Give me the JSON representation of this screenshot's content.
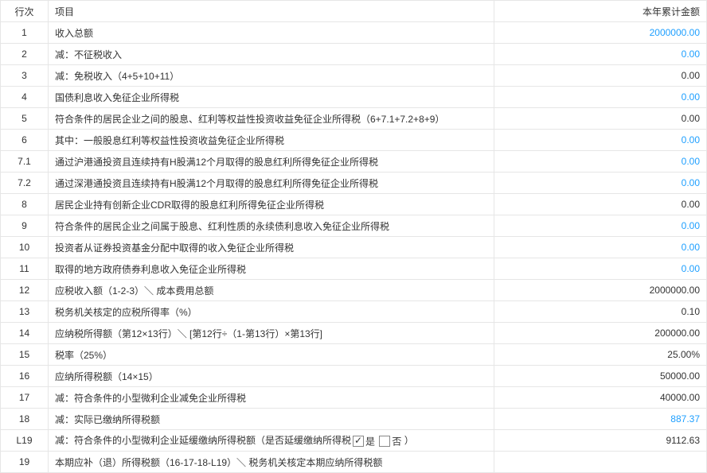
{
  "headers": {
    "rownum": "行次",
    "item": "项目",
    "amount": "本年累计金额"
  },
  "rows": [
    {
      "num": "1",
      "item": "收入总额",
      "amount": "2000000.00",
      "blue": true
    },
    {
      "num": "2",
      "item": "减：不征税收入",
      "amount": "0.00",
      "blue": true
    },
    {
      "num": "3",
      "item": "减：免税收入（4+5+10+11）",
      "amount": "0.00",
      "blue": false
    },
    {
      "num": "4",
      "item": "国债利息收入免征企业所得税",
      "amount": "0.00",
      "blue": true
    },
    {
      "num": "5",
      "item": "符合条件的居民企业之间的股息、红利等权益性投资收益免征企业所得税（6+7.1+7.2+8+9）",
      "amount": "0.00",
      "blue": false
    },
    {
      "num": "6",
      "item": "其中：一般股息红利等权益性投资收益免征企业所得税",
      "amount": "0.00",
      "blue": true
    },
    {
      "num": "7.1",
      "item": "通过沪港通投资且连续持有H股满12个月取得的股息红利所得免征企业所得税",
      "amount": "0.00",
      "blue": true
    },
    {
      "num": "7.2",
      "item": "通过深港通投资且连续持有H股满12个月取得的股息红利所得免征企业所得税",
      "amount": "0.00",
      "blue": true
    },
    {
      "num": "8",
      "item": "居民企业持有创新企业CDR取得的股息红利所得免征企业所得税",
      "amount": "0.00",
      "blue": false
    },
    {
      "num": "9",
      "item": "符合条件的居民企业之间属于股息、红利性质的永续债利息收入免征企业所得税",
      "amount": "0.00",
      "blue": true
    },
    {
      "num": "10",
      "item": "投资者从证券投资基金分配中取得的收入免征企业所得税",
      "amount": "0.00",
      "blue": true
    },
    {
      "num": "11",
      "item": "取得的地方政府债券利息收入免征企业所得税",
      "amount": "0.00",
      "blue": true
    },
    {
      "num": "12",
      "item": "应税收入额（1-2-3）＼ 成本费用总额",
      "amount": "2000000.00",
      "blue": false
    },
    {
      "num": "13",
      "item": "税务机关核定的应税所得率（%）",
      "amount": "0.10",
      "blue": false
    },
    {
      "num": "14",
      "item": "应纳税所得额（第12×13行）＼ [第12行÷（1-第13行）×第13行]",
      "amount": "200000.00",
      "blue": false
    },
    {
      "num": "15",
      "item": "税率（25%）",
      "amount": "25.00%",
      "blue": false
    },
    {
      "num": "16",
      "item": "应纳所得税额（14×15）",
      "amount": "50000.00",
      "blue": false
    },
    {
      "num": "17",
      "item": "减：符合条件的小型微利企业减免企业所得税",
      "amount": "40000.00",
      "blue": false
    },
    {
      "num": "18",
      "item": "减：实际已缴纳所得税额",
      "amount": "887.37",
      "blue": true
    },
    {
      "num": "L19",
      "item": "",
      "amount": "9112.63",
      "blue": false,
      "special": "L19"
    },
    {
      "num": "19",
      "item": "本期应补（退）所得税额（16-17-18-L19）＼ 税务机关核定本期应纳所得税额",
      "amount": "",
      "blue": false
    }
  ],
  "L19": {
    "prefix": "减：符合条件的小型微利企业延缓缴纳所得税额（是否延缓缴纳所得税",
    "yes": "是",
    "no": "否",
    "suffix": "）",
    "checked_yes": true,
    "checked_no": false
  }
}
